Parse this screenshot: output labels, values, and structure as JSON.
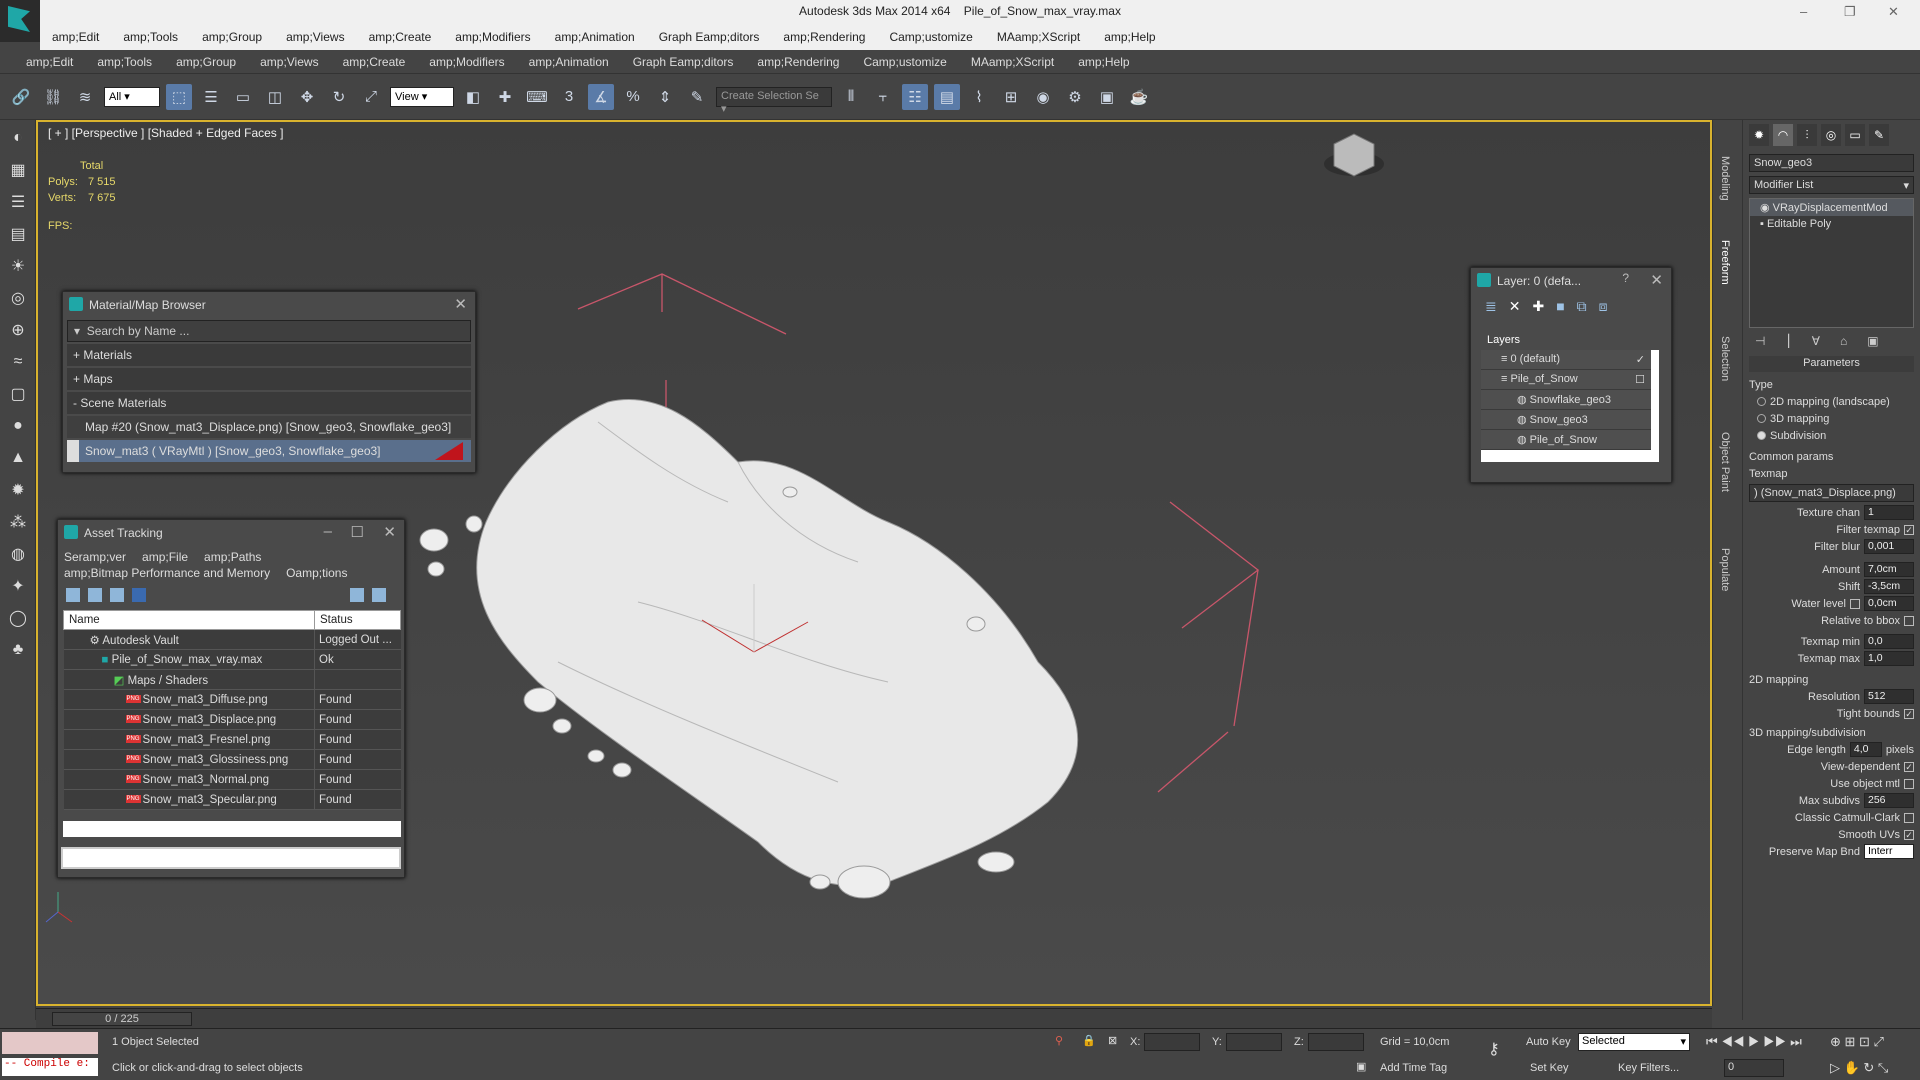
{
  "app": {
    "title": "Autodesk 3ds Max  2014 x64",
    "file": "Pile_of_Snow_max_vray.max",
    "min": "–",
    "max": "❐",
    "close": "✕"
  },
  "menu1": [
    "amp;Edit",
    "amp;Tools",
    "amp;Group",
    "amp;Views",
    "amp;Create",
    "amp;Modifiers",
    "amp;Animation",
    "Graph Eamp;ditors",
    "amp;Rendering",
    "Camp;ustomize",
    "MAamp;XScript",
    "amp;Help"
  ],
  "menu2": [
    "amp;Edit",
    "amp;Tools",
    "amp;Group",
    "amp;Views",
    "amp;Create",
    "amp;Modifiers",
    "amp;Animation",
    "Graph Eamp;ditors",
    "amp;Rendering",
    "Camp;ustomize",
    "MAamp;XScript",
    "amp;Help"
  ],
  "toolbar": {
    "filter_value": "All",
    "refcoord_value": "View",
    "snap_3": "3",
    "selset_placeholder": "Create Selection Se"
  },
  "viewport": {
    "label": "[ + ] [Perspective ] [Shaded + Edged Faces ]",
    "stats_total": "Total",
    "polys_label": "Polys:",
    "polys_value": "7 515",
    "verts_label": "Verts:",
    "verts_value": "7 675",
    "fps_label": "FPS:"
  },
  "matbrowser": {
    "title": "Material/Map Browser",
    "search": "Search by Name ...",
    "materials": "+ Materials",
    "maps": "+ Maps",
    "scene": "- Scene Materials",
    "row1": "Map #20 (Snow_mat3_Displace.png) [Snow_geo3, Snowflake_geo3]",
    "row2": "Snow_mat3  ( VRayMtl ) [Snow_geo3, Snowflake_geo3]"
  },
  "asset": {
    "title": "Asset Tracking",
    "menus": [
      "Seramp;ver",
      "amp;File",
      "amp;Paths",
      "amp;Bitmap Performance and Memory",
      "Oamp;tions"
    ],
    "col_name": "Name",
    "col_status": "Status",
    "rows": [
      {
        "name": "Autodesk Vault",
        "status": "Logged Out ..."
      },
      {
        "name": "Pile_of_Snow_max_vray.max",
        "status": "Ok"
      },
      {
        "name": "Maps / Shaders",
        "status": ""
      },
      {
        "name": "Snow_mat3_Diffuse.png",
        "status": "Found"
      },
      {
        "name": "Snow_mat3_Displace.png",
        "status": "Found"
      },
      {
        "name": "Snow_mat3_Fresnel.png",
        "status": "Found"
      },
      {
        "name": "Snow_mat3_Glossiness.png",
        "status": "Found"
      },
      {
        "name": "Snow_mat3_Normal.png",
        "status": "Found"
      },
      {
        "name": "Snow_mat3_Specular.png",
        "status": "Found"
      }
    ],
    "png_tag": "PNG"
  },
  "layer": {
    "title": "Layer: 0 (defa...",
    "help": "?",
    "header": "Layers",
    "rows": [
      "0 (default)",
      "Pile_of_Snow",
      "Snowflake_geo3",
      "Snow_geo3",
      "Pile_of_Snow"
    ]
  },
  "cmd": {
    "object_name": "Snow_geo3",
    "modlist": "Modifier List",
    "stack": [
      "VRayDisplacementMod",
      "Editable Poly"
    ],
    "params": "Parameters",
    "type": "Type",
    "t1": "2D mapping (landscape)",
    "t2": "3D mapping",
    "t3": "Subdivision",
    "common": "Common params",
    "texmap": "Texmap",
    "texmap_val": ") (Snow_mat3_Displace.png)",
    "texchan_l": "Texture chan",
    "texchan_v": "1",
    "filtex_l": "Filter texmap",
    "filblur_l": "Filter blur",
    "filblur_v": "0,001",
    "amount_l": "Amount",
    "amount_v": "7,0cm",
    "shift_l": "Shift",
    "shift_v": "-3,5cm",
    "water_l": "Water level",
    "water_v": "0,0cm",
    "relbox_l": "Relative to bbox",
    "tmin_l": "Texmap min",
    "tmin_v": "0,0",
    "tmax_l": "Texmap max",
    "tmax_v": "1,0",
    "m2d": "2D mapping",
    "res_l": "Resolution",
    "res_v": "512",
    "tight_l": "Tight bounds",
    "m3d": "3D mapping/subdivision",
    "edge_l": "Edge length",
    "edge_v": "4,0",
    "pixels": "pixels",
    "viewdep_l": "View-dependent",
    "useobj_l": "Use object mtl",
    "maxsub_l": "Max subdivs",
    "maxsub_v": "256",
    "catmull_l": "Classic Catmull-Clark",
    "smooth_l": "Smooth UVs",
    "pmb_l": "Preserve Map Bnd",
    "pmb_v": "Interr"
  },
  "rtabs": [
    "Modeling",
    "Freeform",
    "Selection",
    "Object Paint",
    "Populate"
  ],
  "timeline": {
    "slider": "0 / 225"
  },
  "status": {
    "compile": "-- Compile e:",
    "selected": "1 Object Selected",
    "hint": "Click or click-and-drag to select objects",
    "x": "X:",
    "y": "Y:",
    "z": "Z:",
    "grid": "Grid = 10,0cm",
    "autokey": "Auto Key",
    "setkey": "Set Key",
    "selected_dd": "Selected",
    "keyfilters": "Key Filters...",
    "addtime": "Add Time Tag",
    "frame": "0"
  },
  "colors": {
    "accent": "#d9b32e",
    "selection": "#5a7ba8",
    "brand": "#1fa7a7"
  }
}
